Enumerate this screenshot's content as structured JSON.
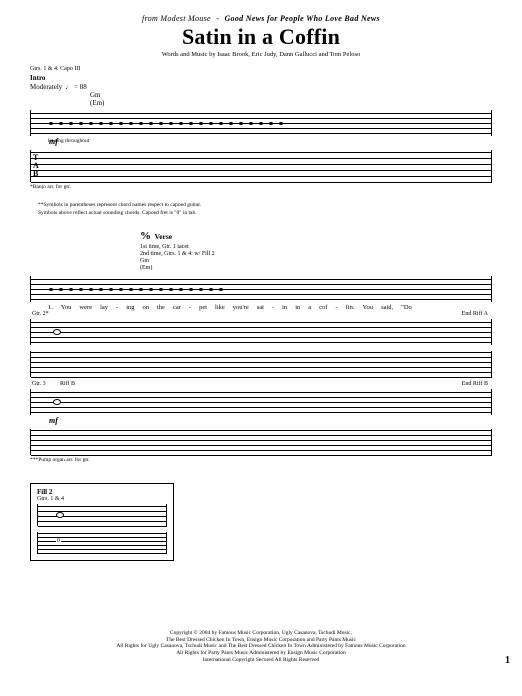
{
  "header": {
    "from_prefix": "from",
    "artist": "Modest Mouse",
    "dash": "-",
    "album": "Good News for People Who Love Bad News",
    "title": "Satin in a Coffin",
    "credits": "Words and Music by Isaac Brook, Eric Judy, Dann Gallucci and Tom Peloso"
  },
  "intro": {
    "capo_note": "Gtrs. 1 & 4: Capo III",
    "section": "Intro",
    "tempo_label": "Moderately",
    "tempo_marking": "♩ = 88",
    "chord_main": "Gm",
    "chord_paren": "(Em)",
    "dynamic": "mf",
    "ring_note": "let ring throughout",
    "footnote1": "*Banjo arr. for gtr.",
    "footnote2a": "**Symbols in parentheses represent chord names respect to capoed guitar.",
    "footnote2b": "Symbols above reflect actual sounding chords. Capoed fret is \"0\" in tab."
  },
  "verse": {
    "segno": "%",
    "label": "Verse",
    "inst1": "1st time, Gtr. 1 tacet",
    "inst2": "2nd time, Gtrs. 1 & 4: w/ Fill 2",
    "chord_main": "Gm",
    "chord_paren": "(Em)",
    "lyric_num": "1.",
    "lyrics": [
      "You",
      "were",
      "lay",
      "-",
      "ing",
      "on",
      "the",
      "car",
      "-",
      "pet",
      "like",
      "you're",
      "sat",
      "-",
      "in",
      "in",
      "a",
      "cof",
      "-",
      "fin.",
      "You",
      "said,",
      "\"Do"
    ],
    "gtr2_label": "Gtr. 2*",
    "riffA_end": "End Riff A",
    "gtr3_label": "Gtr. 3",
    "riffB": "Riff B",
    "riffB_end": "End Riff B",
    "dynamic": "mf",
    "footnote3": "***Pump organ arr. for gtr."
  },
  "end_block": {
    "chord": "Fill 2",
    "gtr_label": "Gtrs. 1 & 4"
  },
  "tab": {
    "t": "T",
    "a": "A",
    "b": "B"
  },
  "copyright": {
    "line1": "Copyright © 2004 by Famous Music Corporation, Ugly Casanova, Tschudi Music,",
    "line2": "The Best Dressed Chicken In Town, Ensign Music Corporation and Party Pants Music",
    "line3": "All Rights for Ugly Casanova, Tschudi Music and The Best Dressed Chicken In Town Administered by Famous Music Corporation",
    "line4": "All Rights for Party Pants Music Administered by Ensign Music Corporation",
    "line5": "International Copyright Secured   All Rights Reserved"
  },
  "page_number": "1"
}
